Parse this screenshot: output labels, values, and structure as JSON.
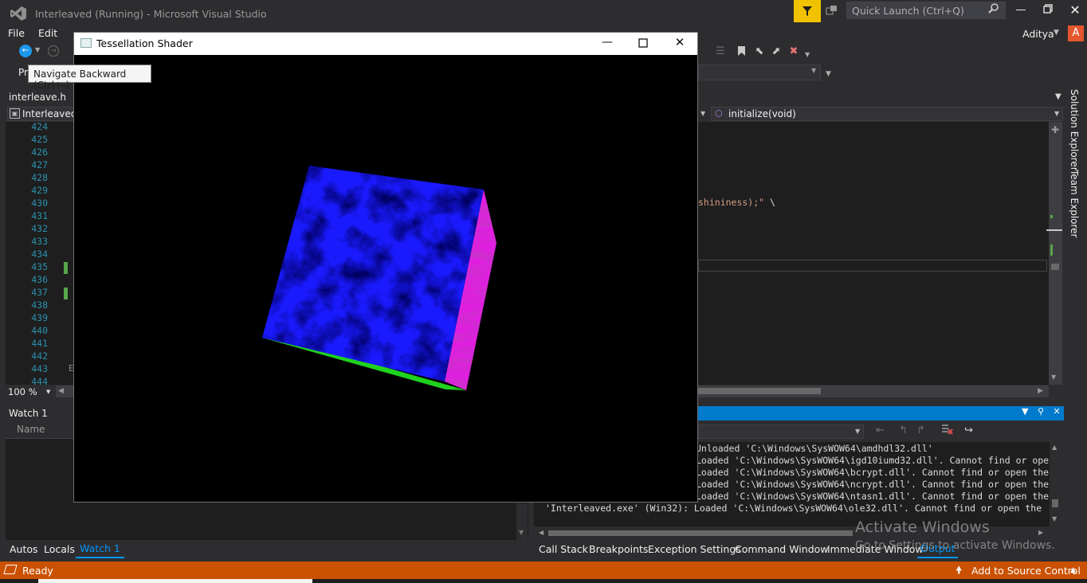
{
  "ide": {
    "title": "Interleaved (Running) - Microsoft Visual Studio",
    "quick_launch_placeholder": "Quick Launch (Ctrl+Q)",
    "user": "Aditya",
    "avatar_letter": "A",
    "accent_color": "#007acc",
    "status_color": "#ca5100"
  },
  "menu": {
    "file": "File",
    "edit": "Edit"
  },
  "tooltip": "Navigate Backward (Ctrl+-)",
  "toolbar_partial_label": "Pr",
  "doc_tab": "interleave.h",
  "navbar": {
    "project": "Interleaved",
    "member": "initialize(void)"
  },
  "editor": {
    "line_numbers": [
      "424",
      "425",
      "426",
      "427",
      "428",
      "429",
      "430",
      "431",
      "432",
      "433",
      "434",
      "435",
      "436",
      "437",
      "438",
      "439",
      "440",
      "441",
      "442",
      "443",
      "444"
    ],
    "changed_lines": [
      "435",
      "437"
    ],
    "code_snippet": "shininess);\"",
    "code_continuation": "\\",
    "collapse_marker": "E",
    "zoom": "100 %"
  },
  "side_tabs": [
    "Solution Explorer",
    "Team Explorer"
  ],
  "watch": {
    "title": "Watch 1",
    "column_name": "Name"
  },
  "bottom_tabs_left": [
    "Autos",
    "Locals",
    "Watch 1"
  ],
  "bottom_tabs_right": [
    "Call Stack",
    "Breakpoints",
    "Exception Settings",
    "Command Window",
    "Immediate Window",
    "Output"
  ],
  "output": {
    "lines": [
      "Unloaded 'C:\\Windows\\SysWOW64\\amdhdl32.dll'",
      "Loaded 'C:\\Windows\\SysWOW64\\igd10iumd32.dll'. Cannot find or ope",
      "Loaded 'C:\\Windows\\SysWOW64\\bcrypt.dll'. Cannot find or open the",
      "Loaded 'C:\\Windows\\SysWOW64\\ncrypt.dll'. Cannot find or open the",
      "Loaded 'C:\\Windows\\SysWOW64\\ntasn1.dll'. Cannot find or open the",
      "'Interleaved.exe' (Win32): Loaded 'C:\\Windows\\SysWOW64\\ole32.dll'. Cannot find or open the"
    ]
  },
  "watermark": {
    "line1": "Activate Windows",
    "line2": "Go to Settings to activate Windows."
  },
  "status": {
    "text": "Ready",
    "source_control": "Add to Source Control"
  },
  "app_window": {
    "title": "Tessellation Shader",
    "cube_colors": {
      "front": "#1a1aff",
      "side": "#e01ee0",
      "bottom": "#1ed21e"
    }
  }
}
